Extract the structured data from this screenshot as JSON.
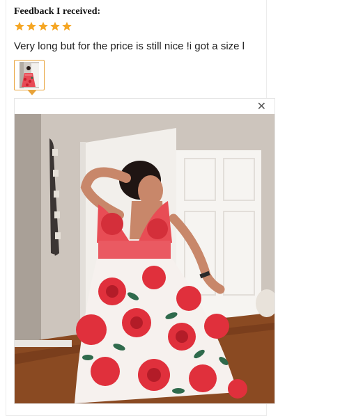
{
  "review": {
    "heading": "Feedback I received:",
    "rating": 5,
    "text": "Very long but for the price is still nice !i got a size l",
    "star_color": "#f5a623",
    "accent_color": "#e8a33a"
  },
  "viewer": {
    "close_icon": "close-icon",
    "close_glyph": "✕"
  }
}
